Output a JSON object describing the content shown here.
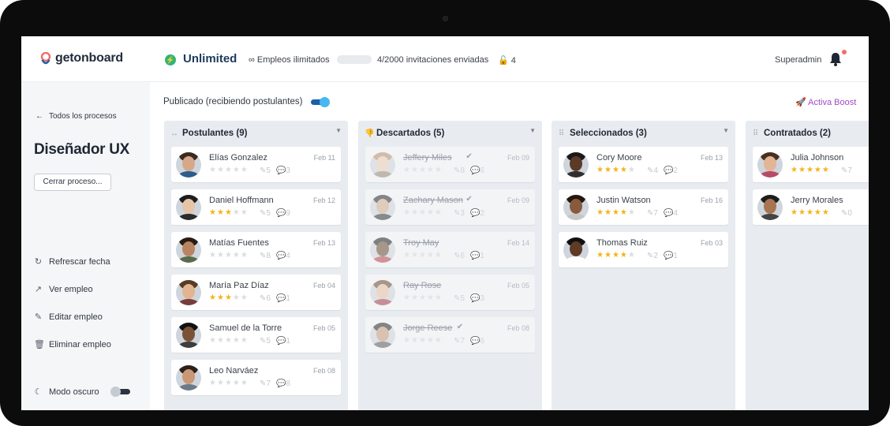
{
  "app": {
    "logo_text": "getonboard",
    "plan_name": "Unlimited",
    "jobs_text": "∞ Empleos ilimitados",
    "invitations_progress": 0.002,
    "invitations_text": "4/2000 invitaciones enviadas",
    "credits_count": "4",
    "user_name": "Superadmin",
    "notification_dot_color": "#ef6f6c",
    "brand_color": "#1e3a5f",
    "accent_boost_color": "#a04bc7"
  },
  "sidebar": {
    "back_label": "Todos los procesos",
    "process_title": "Diseñador UX",
    "close_button": "Cerrar proceso...",
    "refresh": "Refrescar fecha",
    "view_job": "Ver empleo",
    "edit_job": "Editar empleo",
    "delete_job": "Eliminar empleo",
    "dark_mode": "Modo oscuro",
    "dark_mode_on": false
  },
  "main": {
    "published_label": "Publicado (recibiendo postulantes)",
    "published_on": true,
    "boost_label": "Activa Boost",
    "columns": [
      {
        "title": "Postulantes (9)",
        "icon": "arrows-icon",
        "cards": [
          {
            "name": "Elías Gonzalez",
            "date": "Feb 11",
            "rating": 0,
            "tags": "5",
            "comments": "3",
            "discarded": false,
            "checked": false
          },
          {
            "name": "Daniel Hoffmann",
            "date": "Feb 12",
            "rating": 3,
            "tags": "5",
            "comments": "9",
            "discarded": false,
            "checked": false
          },
          {
            "name": "Matías Fuentes",
            "date": "Feb 13",
            "rating": 0,
            "tags": "8",
            "comments": "4",
            "discarded": false,
            "checked": false
          },
          {
            "name": "María Paz Díaz",
            "date": "Feb 04",
            "rating": 3,
            "tags": "6",
            "comments": "1",
            "discarded": false,
            "checked": false
          },
          {
            "name": "Samuel de la Torre",
            "date": "Feb 05",
            "rating": 0,
            "tags": "5",
            "comments": "1",
            "discarded": false,
            "checked": false
          },
          {
            "name": "Leo Narváez",
            "date": "Feb 08",
            "rating": 0,
            "tags": "7",
            "comments": "8",
            "discarded": false,
            "checked": false
          }
        ]
      },
      {
        "title": "Descartados (5)",
        "icon": "thumbs-down-icon",
        "cards": [
          {
            "name": "Jeffery Miles",
            "date": "Feb 09",
            "rating": 0,
            "tags": "8",
            "comments": "6",
            "discarded": true,
            "checked": true
          },
          {
            "name": "Zachary Mason",
            "date": "Feb 09",
            "rating": 0,
            "tags": "3",
            "comments": "2",
            "discarded": true,
            "checked": true
          },
          {
            "name": "Troy May",
            "date": "Feb 14",
            "rating": 0,
            "tags": "6",
            "comments": "1",
            "discarded": true,
            "checked": false
          },
          {
            "name": "Ray Rose",
            "date": "Feb 05",
            "rating": 0,
            "tags": "5",
            "comments": "3",
            "discarded": true,
            "checked": false
          },
          {
            "name": "Jorge Reese",
            "date": "Feb 08",
            "rating": 0,
            "tags": "7",
            "comments": "6",
            "discarded": true,
            "checked": true
          }
        ]
      },
      {
        "title": "Seleccionados (3)",
        "icon": "drag-handle-icon",
        "cards": [
          {
            "name": "Cory Moore",
            "date": "Feb 13",
            "rating": 4,
            "tags": "4",
            "comments": "2",
            "discarded": false,
            "checked": false
          },
          {
            "name": "Justin Watson",
            "date": "Feb 16",
            "rating": 4,
            "tags": "7",
            "comments": "4",
            "discarded": false,
            "checked": false
          },
          {
            "name": "Thomas Ruiz",
            "date": "Feb 03",
            "rating": 4,
            "tags": "2",
            "comments": "1",
            "discarded": false,
            "checked": false
          }
        ]
      },
      {
        "title": "Contratados (2)",
        "icon": "drag-handle-icon",
        "cards": [
          {
            "name": "Julia Johnson",
            "date": "",
            "rating": 5,
            "tags": "7",
            "comments": "",
            "discarded": false,
            "checked": false
          },
          {
            "name": "Jerry Morales",
            "date": "",
            "rating": 5,
            "tags": "0",
            "comments": "",
            "discarded": false,
            "checked": false
          }
        ]
      }
    ]
  }
}
